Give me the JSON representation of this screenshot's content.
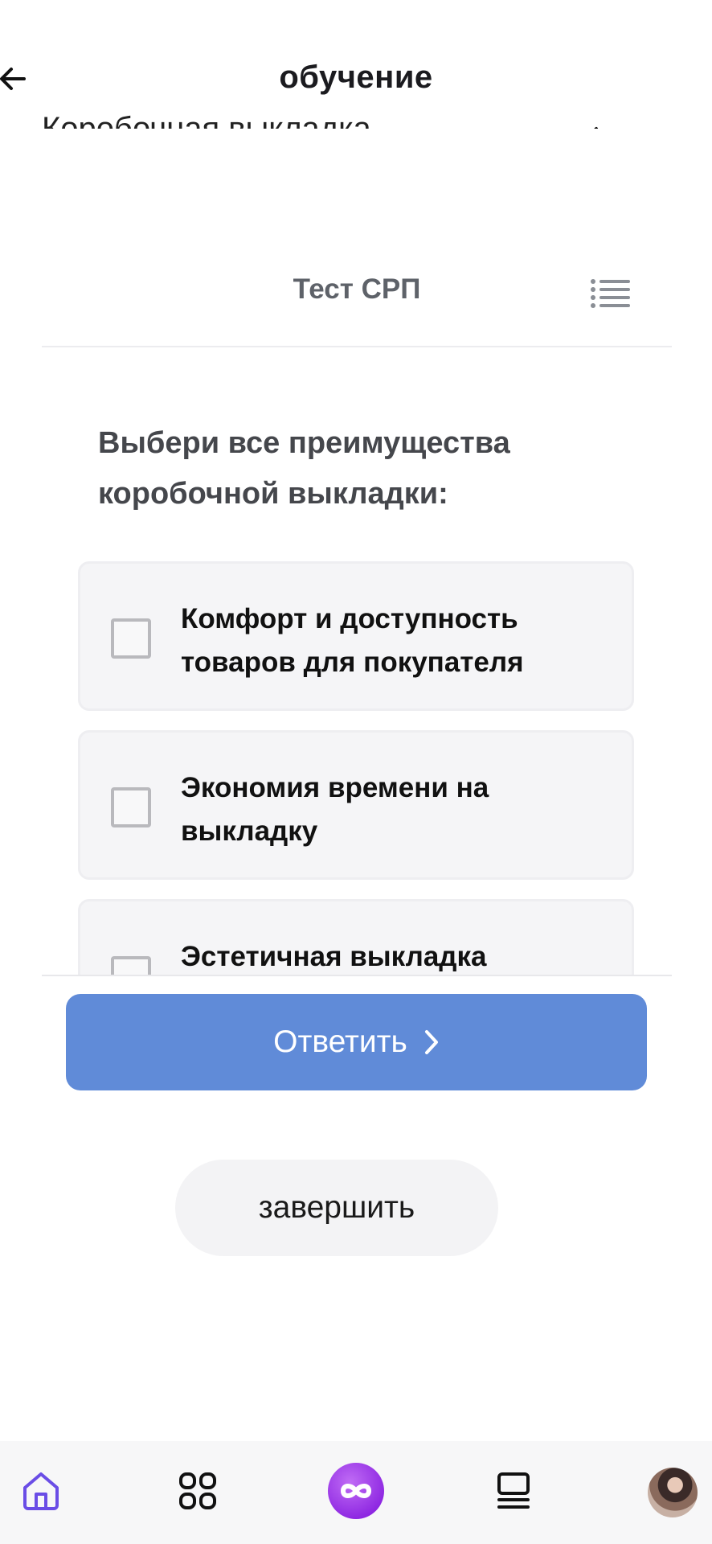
{
  "header": {
    "title": "обучение",
    "module_title": "Коробочная выкладка",
    "back_icon": "arrow-left-icon",
    "collapse_icon": "arrow-down-left-icon"
  },
  "test": {
    "title": "Тест СРП",
    "list_icon": "list-icon"
  },
  "question": "Выбери все преимущества коробочной выкладки:",
  "options": [
    {
      "label": "Комфорт и доступность товаров для покупателя",
      "checked": false
    },
    {
      "label": "Экономия времени на выкладку",
      "checked": false
    },
    {
      "label": "Эстетичная выкладка",
      "checked": false
    }
  ],
  "actions": {
    "submit_label": "Ответить",
    "finish_label": "завершить"
  },
  "tabbar": {
    "items": [
      {
        "icon": "home-icon",
        "active": true
      },
      {
        "icon": "grid-icon",
        "active": false
      },
      {
        "icon": "infinity-icon",
        "active": false
      },
      {
        "icon": "courses-icon",
        "active": false
      },
      {
        "icon": "avatar",
        "active": false
      }
    ]
  },
  "colors": {
    "accent": "#608bd8",
    "tab_active": "#6a4de6",
    "infinity_bg": "#9c33e8"
  }
}
